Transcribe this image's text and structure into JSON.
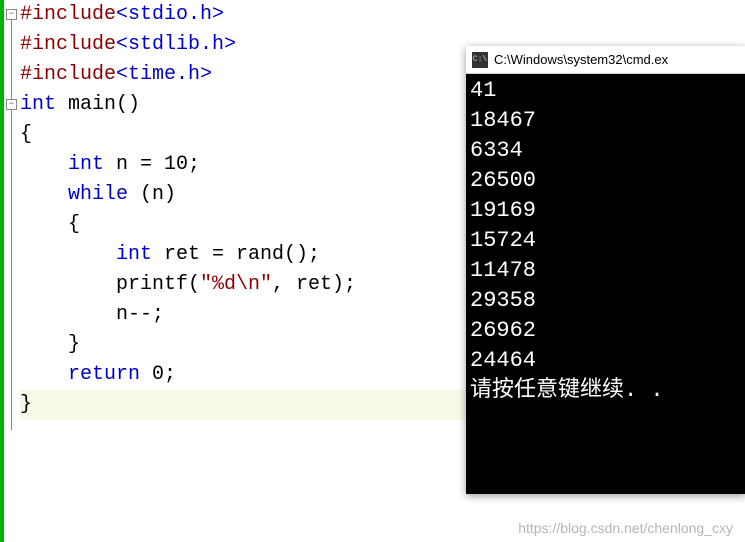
{
  "code": {
    "lines": [
      {
        "segments": [
          {
            "cls": "kw-brown",
            "t": "#include"
          },
          {
            "cls": "kw-blue",
            "t": "<stdio.h>"
          }
        ],
        "fold": "minus"
      },
      {
        "segments": [
          {
            "cls": "kw-brown",
            "t": "#include"
          },
          {
            "cls": "kw-blue",
            "t": "<stdlib.h>"
          }
        ]
      },
      {
        "segments": [
          {
            "cls": "kw-brown",
            "t": "#include"
          },
          {
            "cls": "kw-blue",
            "t": "<time.h>"
          }
        ]
      },
      {
        "segments": [
          {
            "cls": "kw-blue",
            "t": "int"
          },
          {
            "cls": "plain",
            "t": " main()"
          }
        ],
        "fold": "minus"
      },
      {
        "segments": [
          {
            "cls": "plain",
            "t": "{"
          }
        ]
      },
      {
        "segments": [
          {
            "cls": "plain",
            "t": "    "
          },
          {
            "cls": "kw-blue",
            "t": "int"
          },
          {
            "cls": "plain",
            "t": " n = 10;"
          }
        ]
      },
      {
        "segments": [
          {
            "cls": "plain",
            "t": "    "
          },
          {
            "cls": "kw-blue",
            "t": "while"
          },
          {
            "cls": "plain",
            "t": " (n)"
          }
        ]
      },
      {
        "segments": [
          {
            "cls": "plain",
            "t": "    {"
          }
        ]
      },
      {
        "segments": [
          {
            "cls": "plain",
            "t": "        "
          },
          {
            "cls": "kw-blue",
            "t": "int"
          },
          {
            "cls": "plain",
            "t": " ret = rand();"
          }
        ]
      },
      {
        "segments": [
          {
            "cls": "plain",
            "t": "        printf("
          },
          {
            "cls": "str",
            "t": "\"%d\\n\""
          },
          {
            "cls": "plain",
            "t": ", ret);"
          }
        ]
      },
      {
        "segments": [
          {
            "cls": "plain",
            "t": "        n--;"
          }
        ]
      },
      {
        "segments": [
          {
            "cls": "plain",
            "t": "    }"
          }
        ]
      },
      {
        "segments": [
          {
            "cls": "plain",
            "t": "    "
          },
          {
            "cls": "kw-blue",
            "t": "return"
          },
          {
            "cls": "plain",
            "t": " 0;"
          }
        ]
      },
      {
        "segments": [
          {
            "cls": "plain",
            "t": "}"
          }
        ],
        "highlight": true
      }
    ]
  },
  "console": {
    "title": "C:\\Windows\\system32\\cmd.ex",
    "icon_label": "C:\\",
    "output": [
      "41",
      "18467",
      "6334",
      "26500",
      "19169",
      "15724",
      "11478",
      "29358",
      "26962",
      "24464",
      "请按任意键继续. ."
    ]
  },
  "watermark": "https://blog.csdn.net/chenlong_cxy"
}
